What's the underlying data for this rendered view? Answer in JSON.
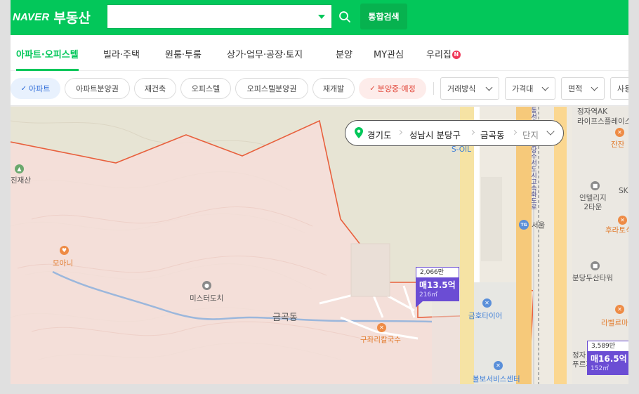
{
  "header": {
    "logo_brand": "NAVER",
    "logo_service": "부동산",
    "search_placeholder": "",
    "all_search_label": "통합검색"
  },
  "tabs": [
    {
      "label": "아파트·오피스텔",
      "active": true
    },
    {
      "label": "빌라·주택"
    },
    {
      "label": "원룸·투룸"
    },
    {
      "label": "상가·업무·공장·토지"
    },
    {
      "label": "분양"
    },
    {
      "label": "MY관심"
    },
    {
      "label": "우리집",
      "badge": "N"
    }
  ],
  "filters": {
    "chips": [
      {
        "label": "아파트",
        "style": "blue",
        "checked": true
      },
      {
        "label": "아파트분양권"
      },
      {
        "label": "재건축"
      },
      {
        "label": "오피스텔"
      },
      {
        "label": "오피스텔분양권"
      },
      {
        "label": "재개발"
      },
      {
        "label": "분양중·예정",
        "style": "red",
        "checked": true
      }
    ],
    "dropdowns": [
      "거래방식",
      "가격대",
      "면적",
      "사용승"
    ]
  },
  "location": {
    "province": "경기도",
    "city": "성남시 분당구",
    "dong": "금곡동",
    "complex": "단지"
  },
  "map": {
    "labels": {
      "jinjaesan": "진재산",
      "moani": "모아니",
      "mister_donut": "미스터도치",
      "geumgok_dong": "금곡동",
      "jujeori": "구좌리칼국수",
      "geumho_tire": "금호타이어",
      "service_center": "볼보서비스센터",
      "soil": "S-OIL",
      "seoul_tag": "서울",
      "jeongja_ak": "정자역AK\n라이프스플레이스",
      "jeongja_ak_line1": "정자역AK",
      "jeongja_ak_line2": "라이프스플레이스",
      "jjan": "잔잔",
      "sk_u": "SK U타",
      "intelligence_line1": "인텔리지",
      "intelligence_line2": "2타운",
      "hura": "후라토식당",
      "bundang_doosan": "분당두산타워",
      "labelle": "라벨르마망",
      "jeongja_fr_line1": "정자",
      "jeongja_fr_line2": "푸르지",
      "road_vertical": "동서울방향 분당수서도시고속화도로"
    },
    "markers": [
      {
        "unit_price": "2,066만",
        "price": "매13.5억",
        "area": "216㎡"
      },
      {
        "unit_price": "3,589만",
        "price": "매16.5억",
        "area": "152㎡"
      }
    ]
  },
  "colors": {
    "naver_green": "#03c75a",
    "marker_purple": "#6b4dd4",
    "boundary": "#e85d3a",
    "active_chip_blue": "#2d6bd8",
    "active_chip_red": "#e2483b"
  }
}
